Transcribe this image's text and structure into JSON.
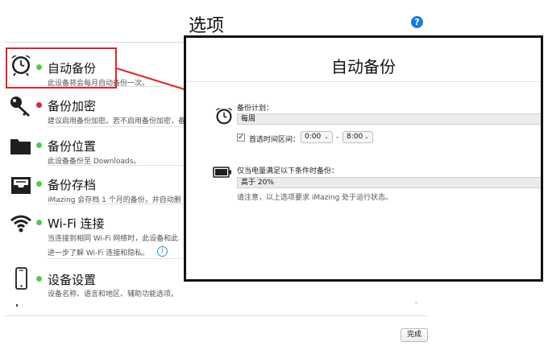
{
  "header": {
    "title": "选项",
    "help_icon": "question-icon",
    "help_glyph": "?"
  },
  "items": [
    {
      "icon": "alarm-clock-icon",
      "status": "green",
      "name": "自动备份",
      "desc": "此设备将会每月自动备份一次。"
    },
    {
      "icon": "key-icon",
      "status": "red",
      "name": "备份加密",
      "desc": "建议启用备份加密。若不启用备份加密，备"
    },
    {
      "icon": "folder-icon",
      "status": "green",
      "name": "备份位置",
      "desc": "此设备备份至 Downloads。"
    },
    {
      "icon": "archive-tray-icon",
      "status": "green",
      "name": "备份存档",
      "desc": "iMazing 会存档 1 个月的备份，并自动删"
    },
    {
      "icon": "wifi-icon",
      "status": "green",
      "name": "Wi-Fi 连接",
      "desc": "当连接到相同 Wi-Fi 网络时，此设备和此",
      "link": "进一步了解 Wi-Fi 连接和隐私。"
    },
    {
      "icon": "phone-icon",
      "status": "green",
      "name": "设备设置",
      "desc": "设备名称、语言和地区、辅助功能选项。"
    }
  ],
  "footer": {
    "done_label": "完成",
    "scroll_glyph": "⌄"
  },
  "popup": {
    "title": "自动备份",
    "schedule_label": "备份计划：",
    "schedule_value": "每周",
    "preferred_checkbox_mark": "✓",
    "preferred_label": "首选时间区间：",
    "time_start": "0:00",
    "time_end": "8:00",
    "time_dash": "-",
    "battery_label": "仅当电量满足以下条件时备份：",
    "battery_value": "高于 20%",
    "note": "请注意，以上选项要求 iMazing 处于运行状态。"
  },
  "colors": {
    "accent_red": "#e3242b",
    "status_green": "#56c84c",
    "status_red": "#e0262a",
    "help_blue": "#1a7bd6"
  }
}
